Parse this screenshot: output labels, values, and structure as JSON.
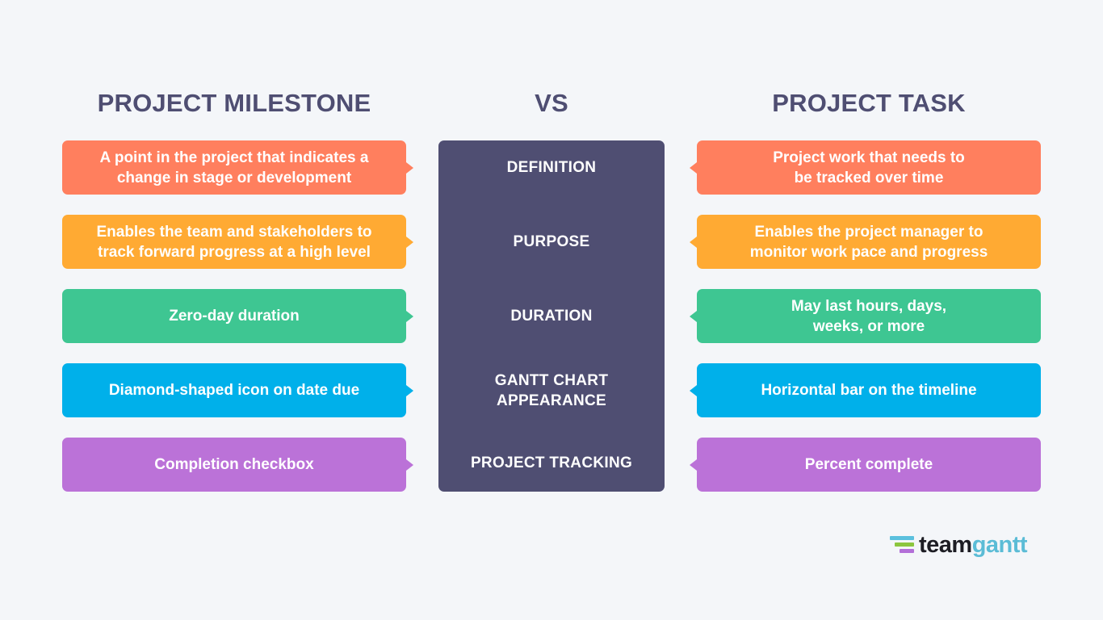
{
  "headings": {
    "left": "PROJECT MILESTONE",
    "middle": "VS",
    "right": "PROJECT TASK"
  },
  "rows": [
    {
      "category": "DEFINITION",
      "milestone": "A point in the project that indicates a\nchange in stage or development",
      "task": "Project work that needs to\nbe tracked over time",
      "color": "#ff7f5e"
    },
    {
      "category": "PURPOSE",
      "milestone": "Enables the team and stakeholders to\ntrack forward progress at a high level",
      "task": "Enables the project manager to\nmonitor work pace and progress",
      "color": "#ffaa33"
    },
    {
      "category": "DURATION",
      "milestone": "Zero-day duration",
      "task": "May last hours, days,\nweeks, or more",
      "color": "#3ec692"
    },
    {
      "category": "GANTT CHART\nAPPEARANCE",
      "milestone": "Diamond-shaped icon on date due",
      "task": "Horizontal bar on the timeline",
      "color": "#00b0ea"
    },
    {
      "category": "PROJECT TRACKING",
      "milestone": "Completion checkbox",
      "task": "Percent complete",
      "color": "#bb72d8"
    }
  ],
  "colors": {
    "background": "#f4f6f9",
    "heading": "#4f4e72",
    "center_panel": "#4f4e72"
  },
  "logo": {
    "part1": "team",
    "part2": "gantt",
    "icon": "teamgantt-bars-icon"
  }
}
